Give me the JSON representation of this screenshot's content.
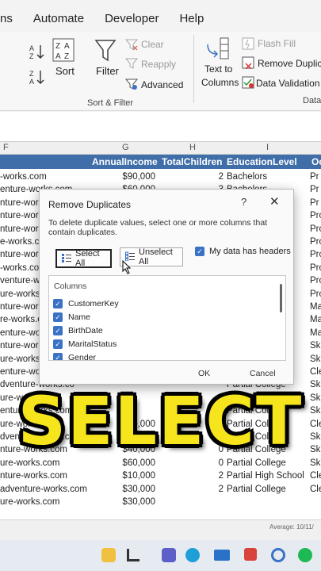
{
  "menu": [
    "ns",
    "Automate",
    "Developer",
    "Help"
  ],
  "ribbon": {
    "sort": "Sort",
    "filter": "Filter",
    "clear": "Clear",
    "reapply": "Reapply",
    "advanced": "Advanced",
    "text_to_columns_1": "Text to",
    "text_to_columns_2": "Columns",
    "flash_fill": "Flash Fill",
    "remove_duplicates": "Remove Duplica",
    "data_validation": "Data Validation",
    "group_sort_filter": "Sort & Filter",
    "group_data": "Data"
  },
  "column_letters": {
    "f": "F",
    "g": "G",
    "h": "H",
    "i": "I"
  },
  "sheet": {
    "headers": {
      "g": "AnnualIncome",
      "h": "TotalChildren",
      "i": "EducationLevel",
      "j": "Oc"
    },
    "rows": [
      {
        "f": "-works.com",
        "g": "$90,000",
        "h": "2",
        "i": "Bachelors",
        "j": "Pr"
      },
      {
        "f": "enture-works.com",
        "g": "$60,000",
        "h": "3",
        "i": "Bachelors",
        "j": "Pr"
      },
      {
        "f": "nture-works.com",
        "g": "",
        "h": "",
        "i": "",
        "j": "Pr"
      },
      {
        "f": "nture-work",
        "g": "",
        "h": "",
        "i": "",
        "j": "Pro"
      },
      {
        "f": "nture-work",
        "g": "",
        "h": "",
        "i": "",
        "j": "Pro"
      },
      {
        "f": "e-works.co",
        "g": "",
        "h": "",
        "i": "",
        "j": "Pro"
      },
      {
        "f": "nture-work",
        "g": "",
        "h": "",
        "i": "",
        "j": "Pro"
      },
      {
        "f": "-works.com",
        "g": "",
        "h": "",
        "i": "",
        "j": "Prof"
      },
      {
        "f": "venture-wo",
        "g": "",
        "h": "",
        "i": "",
        "j": "Prof"
      },
      {
        "f": "ure-works.c",
        "g": "",
        "h": "",
        "i": "",
        "j": "Prof"
      },
      {
        "f": "nture-work",
        "g": "",
        "h": "",
        "i": "",
        "j": "Mana"
      },
      {
        "f": "re-works.co",
        "g": "",
        "h": "",
        "i": "",
        "j": "Mana"
      },
      {
        "f": "enture-wor",
        "g": "",
        "h": "",
        "i": "",
        "j": "Mana"
      },
      {
        "f": "nture-works",
        "g": "",
        "h": "",
        "i": "",
        "j": "Skille"
      },
      {
        "f": "ure-works",
        "g": "",
        "h": "",
        "i": "",
        "j": "Skille"
      },
      {
        "f": "enture-works",
        "g": "$30,000",
        "h": "4",
        "i": "High School",
        "j": "Cleric"
      },
      {
        "f": "dventure-works.co",
        "g": "",
        "h": "",
        "i": "Partial College",
        "j": "Skille"
      },
      {
        "f": "ure-works.com",
        "g": "",
        "h": "0",
        "i": "High School",
        "j": "Skille"
      },
      {
        "f": "enture-works.com",
        "g": "",
        "h": "",
        "i": "Partial College",
        "j": "Skille"
      },
      {
        "f": "ure-works.com",
        "g": "$30,000",
        "h": "2",
        "i": "Partial College",
        "j": "Cleric"
      },
      {
        "f": "dventure-works.com",
        "g": "$30,000",
        "h": "0",
        "i": "Partial College",
        "j": "Skilled"
      },
      {
        "f": "nture-works.com",
        "g": "$40,000",
        "h": "0",
        "i": "Partial College",
        "j": "Skilled"
      },
      {
        "f": "ure-works.com",
        "g": "$60,000",
        "h": "0",
        "i": "Partial College",
        "j": "Skilled"
      },
      {
        "f": "nture-works.com",
        "g": "$10,000",
        "h": "2",
        "i": "Partial High School",
        "j": "Clerica"
      },
      {
        "f": "adventure-works.com",
        "g": "$30,000",
        "h": "2",
        "i": "Partial College",
        "j": "Clerica"
      },
      {
        "f": "ure-works.com",
        "g": "$30,000",
        "h": "",
        "i": "",
        "j": ""
      }
    ]
  },
  "dialog": {
    "title": "Remove Duplicates",
    "help": "?",
    "close": "✕",
    "description": "To delete duplicate values, select one or more columns that contain duplicates.",
    "select_all": "Select All",
    "unselect_all": "Unselect All",
    "headers_checkbox": "My data has headers",
    "columns_title": "Columns",
    "columns": [
      "CustomerKey",
      "Name",
      "BirthDate",
      "MaritalStatus",
      "Gender"
    ],
    "ok": "OK",
    "cancel": "Cancel"
  },
  "status": {
    "average": "Average: 10/11/"
  },
  "caption": "SELECT",
  "colors": {
    "header_blue": "#3f6ea8",
    "checkbox_blue": "#3a72c4",
    "caption_yellow": "#f6e51c"
  }
}
